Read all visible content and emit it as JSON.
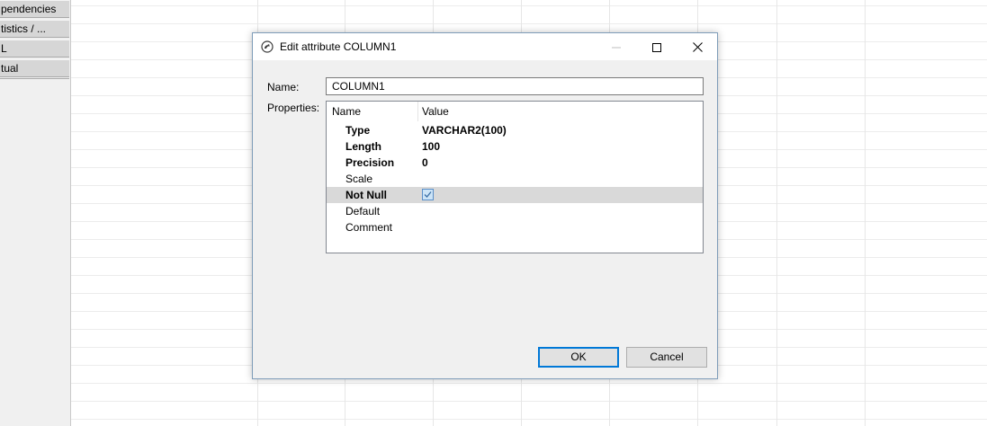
{
  "left_panel": {
    "tabs": [
      "pendencies",
      "tistics / ...",
      "L",
      "tual"
    ]
  },
  "dialog": {
    "title": "Edit attribute COLUMN1",
    "name_label": "Name:",
    "name_value": "COLUMN1",
    "properties_label": "Properties:",
    "table": {
      "columns": [
        "Name",
        "Value"
      ],
      "rows": [
        {
          "name": "Type",
          "value": "VARCHAR2(100)",
          "bold": true
        },
        {
          "name": "Length",
          "value": "100",
          "bold": true
        },
        {
          "name": "Precision",
          "value": "0",
          "bold": true
        },
        {
          "name": "Scale",
          "value": "",
          "bold": false
        },
        {
          "name": "Not Null",
          "value_checkbox": true,
          "bold": true,
          "selected": true
        },
        {
          "name": "Default",
          "value": "",
          "bold": false
        },
        {
          "name": "Comment",
          "value": "",
          "bold": false
        }
      ]
    },
    "ok_label": "OK",
    "cancel_label": "Cancel"
  },
  "colors": {
    "accent": "#0078d7",
    "selected_row": "#d9d9d9",
    "dialog_bg": "#f0f0f0"
  }
}
